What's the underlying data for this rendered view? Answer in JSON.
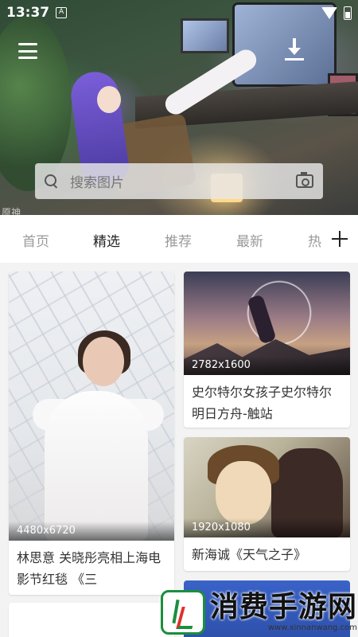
{
  "status_bar": {
    "time": "13:37",
    "notification": "A"
  },
  "hero": {
    "corner_text": "原神"
  },
  "search": {
    "placeholder": "搜索图片"
  },
  "tabs": [
    {
      "label": "首页",
      "active": false
    },
    {
      "label": "精选",
      "active": true
    },
    {
      "label": "推荐",
      "active": false
    },
    {
      "label": "最新",
      "active": false
    },
    {
      "label": "热",
      "active": false
    }
  ],
  "cards": [
    {
      "resolution": "4480x6720",
      "caption": "林思意 关晓彤亮相上海电影节红毯 《三"
    },
    {
      "resolution": "2782x1600",
      "caption": "史尔特尔女孩子史尔特尔明日方舟-触站"
    },
    {
      "resolution": "1920x1080",
      "caption": "新海诚《天气之子》"
    }
  ],
  "watermark": {
    "title": "消费手游网",
    "url": "www.xinnanwang.com"
  },
  "colors": {
    "tab_active": "#222222",
    "tab_inactive": "#9a9a9a",
    "brand_green": "#1a8f3d"
  }
}
